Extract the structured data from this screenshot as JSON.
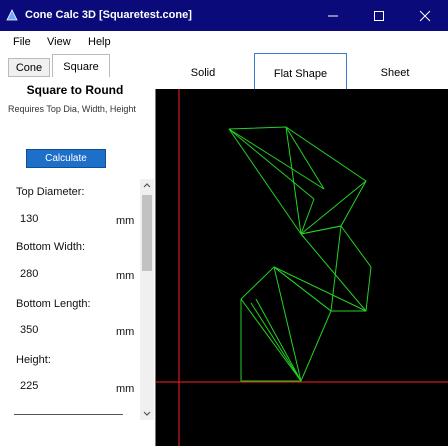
{
  "window": {
    "title": "Cone Calc 3D [Squaretest.cone]",
    "icon": "cone-app-icon",
    "controls": [
      "minimize-icon",
      "maximize-icon",
      "close-icon"
    ]
  },
  "menu": {
    "file": "File",
    "view": "View",
    "help": "Help"
  },
  "left_tabs": [
    {
      "label": "Cone",
      "active": false
    },
    {
      "label": "Square",
      "active": true
    }
  ],
  "panel": {
    "title": "Square to Round",
    "note": "Requires Top Dia, Width, Height",
    "calculate_label": "Calculate",
    "fields": [
      {
        "label": "Top Diameter:",
        "value": "130",
        "unit": "mm"
      },
      {
        "label": "Bottom Width:",
        "value": "280",
        "unit": "mm"
      },
      {
        "label": "Bottom Length:",
        "value": "350",
        "unit": "mm"
      },
      {
        "label": "Height:",
        "value": "225",
        "unit": "mm"
      }
    ]
  },
  "view_tabs": [
    {
      "label": "Solid",
      "active": false
    },
    {
      "label": "Flat Shape",
      "active": true
    },
    {
      "label": "Sheet",
      "active": false
    }
  ],
  "colors": {
    "titlebar": "#0a0a7a",
    "accent": "#1e6fc7",
    "canvas_bg": "#000000",
    "crosshair": "#ff2020",
    "flat_shape_lines": "#22d322"
  }
}
